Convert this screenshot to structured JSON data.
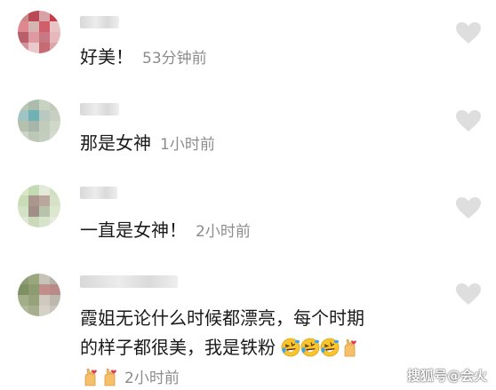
{
  "comments": [
    {
      "text_lines": [
        "好美！"
      ],
      "time": "53分钟前",
      "avatar_colors": [
        "#c98a86",
        "#b84a55",
        "#d9a3a6",
        "#c53d4d",
        "#e08890",
        "#d6b4b2",
        "#cf5f6b",
        "#e9c4c5",
        "#b8606a",
        "#de9aa0",
        "#c77882",
        "#e6b8bc",
        "#d1949c",
        "#ebc8cb",
        "#c66a74",
        "#dba5aa"
      ]
    },
    {
      "text_lines": [
        "那是女神"
      ],
      "time": "1小时前",
      "avatar_colors": [
        "#b7c7b3",
        "#a9bcae",
        "#c8d3c1",
        "#bfcab9",
        "#a0c4c4",
        "#6fb1b5",
        "#b8c9bf",
        "#c7d0c0",
        "#b5c1ae",
        "#a6b6a8",
        "#c1ccbb",
        "#d0d8c9",
        "#cdd6c6",
        "#bcc7b6",
        "#c4cebe",
        "#d4dccd"
      ]
    },
    {
      "text_lines": [
        "一直是女神！"
      ],
      "time": "2小时前",
      "avatar_colors": [
        "#d9e6c8",
        "#c4dab2",
        "#e3ead9",
        "#d0dfc2",
        "#c8dcb6",
        "#a9978d",
        "#b9a79e",
        "#d6e2c8",
        "#d3e1c4",
        "#9f8f86",
        "#b7c4a9",
        "#dde7d0",
        "#e0e8d5",
        "#cbd9bb",
        "#d8e3cb",
        "#e6ecdc"
      ]
    },
    {
      "text_lines": [
        "霞姐无论什么时候都漂亮，每个时期",
        "的样子都很美，我是铁粉"
      ],
      "time": "2小时前",
      "avatar_colors": [
        "#8f9c73",
        "#9aa67c",
        "#c7c3b8",
        "#b5b2a8",
        "#7f9063",
        "#8d9b70",
        "#c28e8b",
        "#b98a88",
        "#a3ad88",
        "#95a27a",
        "#cfc9be",
        "#bcb8ae",
        "#b0b89a",
        "#a6ae8f",
        "#d6d1c7",
        "#c9c5bb"
      ]
    }
  ],
  "icons": {
    "like": "heart-icon",
    "laugh": "rolling-laughing-emoji",
    "heart_hands": "finger-heart-emoji"
  },
  "colors": {
    "text": "#1a1a1a",
    "time": "#8c8c8c",
    "heart": "#dedede",
    "emoji_face": "#f8c52c"
  },
  "watermark": "搜狐号@会火"
}
